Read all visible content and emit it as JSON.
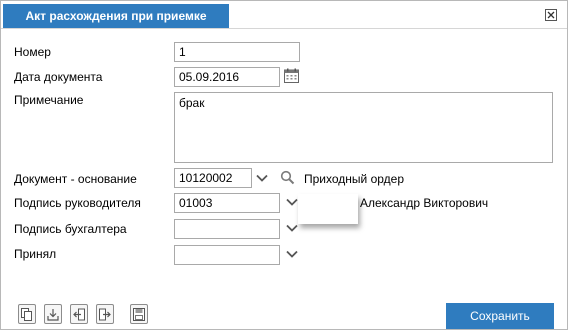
{
  "dialog": {
    "title": "Акт расхождения при приемке",
    "close_icon": "close-icon"
  },
  "form": {
    "number": {
      "label": "Номер",
      "value": "1"
    },
    "doc_date": {
      "label": "Дата документа",
      "value": "05.09.2016",
      "icon": "calendar-icon"
    },
    "note": {
      "label": "Примечание",
      "value": "брак"
    },
    "base_doc": {
      "label": "Документ - основание",
      "value": "10120002",
      "extra": "Приходный ордер",
      "icon": "search-icon"
    },
    "head_signature": {
      "label": "Подпись руководителя",
      "value": "01003",
      "extra": "Александр Викторович"
    },
    "accountant_signature": {
      "label": "Подпись бухгалтера",
      "value": ""
    },
    "accepted_by": {
      "label": "Принял",
      "value": ""
    }
  },
  "toolbar": {
    "icons": [
      "copy-icon",
      "download-icon",
      "import-icon",
      "export-icon",
      "save-disk-icon"
    ]
  },
  "actions": {
    "save_label": "Сохранить"
  },
  "colors": {
    "accent": "#2f7cbf",
    "border": "#a9a9a9"
  }
}
